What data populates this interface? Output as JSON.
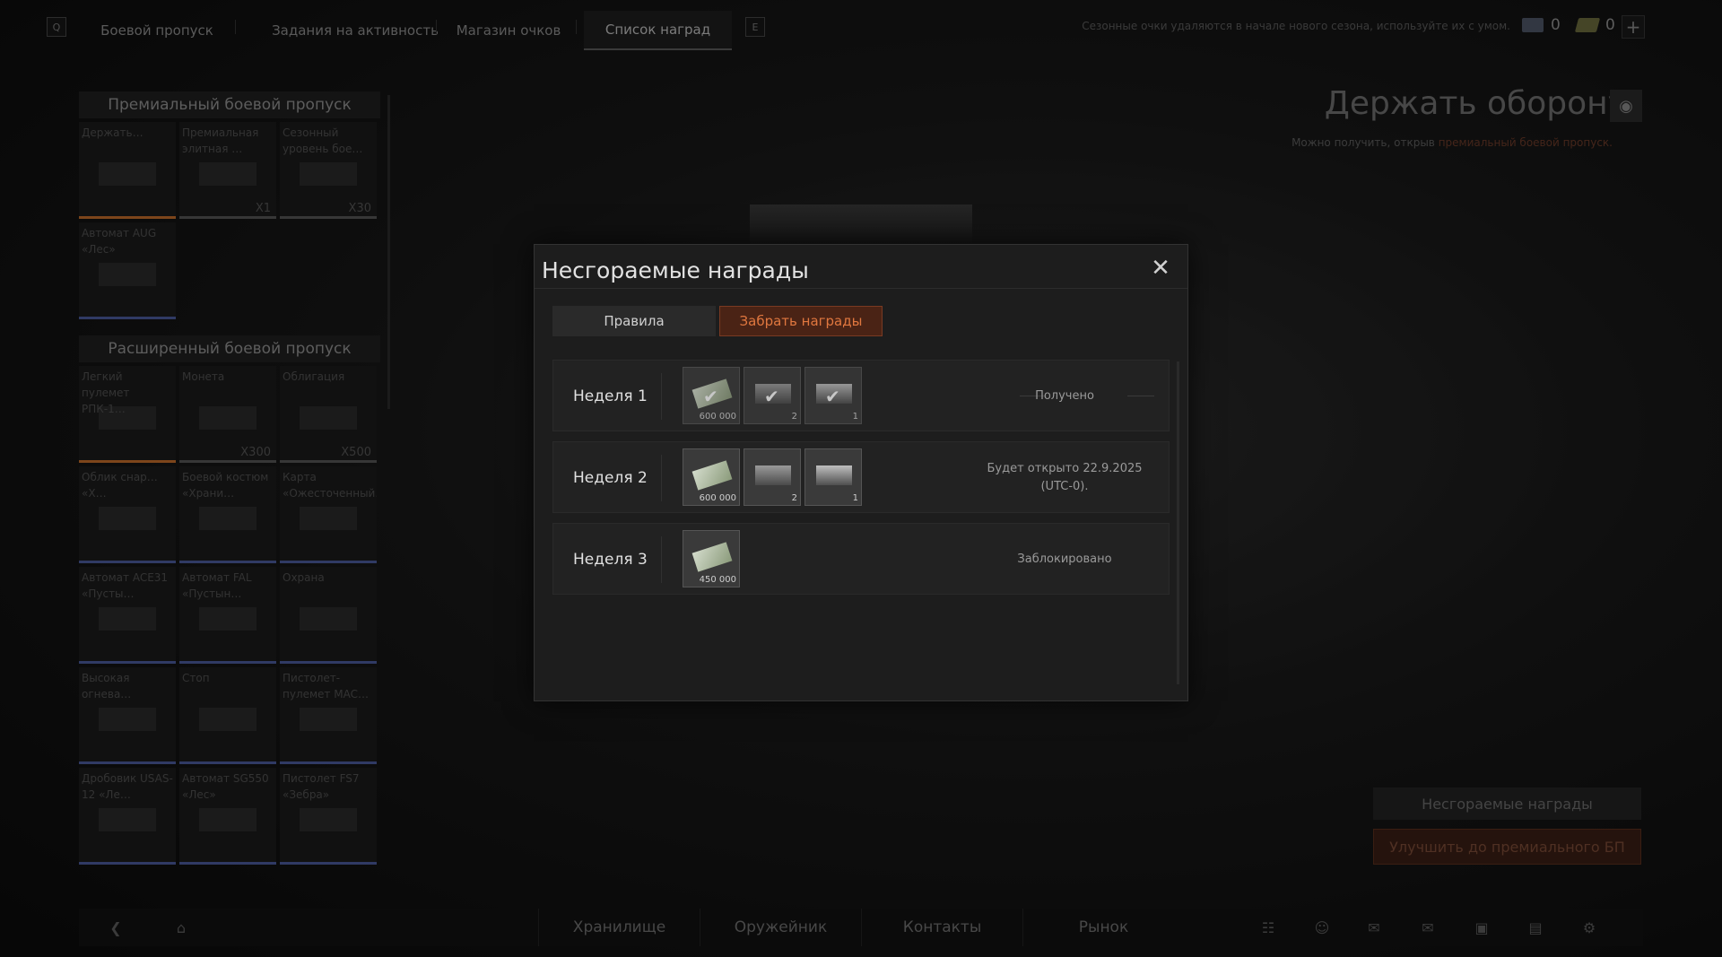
{
  "topnav": {
    "key_left": "Q",
    "key_right": "E",
    "tabs": [
      {
        "label": "Боевой пропуск"
      },
      {
        "label": "Задания на активность"
      },
      {
        "label": "Магазин очков"
      },
      {
        "label": "Список наград"
      }
    ],
    "active_tab": "Список наград",
    "season_note": "Сезонные очки удаляются в начале нового сезона, используйте их с умом.",
    "currency_1": "0",
    "currency_2": "0",
    "plus": "+"
  },
  "left_panel": {
    "premium_title": "Премиальный боевой пропуск",
    "premium_items": [
      {
        "name": "Держать…",
        "qty": "",
        "bar": "#c06a2a"
      },
      {
        "name": "Премиальная элитная …",
        "qty": "X1",
        "bar": "#555555"
      },
      {
        "name": "Сезонный уровень бое…",
        "qty": "X30",
        "bar": "#555555"
      },
      {
        "name": "Автомат AUG «Лес»",
        "qty": "",
        "bar": "#4a5a9a"
      }
    ],
    "extended_title": "Расширенный боевой пропуск",
    "extended_items": [
      {
        "name": "Легкий пулемет РПК-1…",
        "qty": "",
        "bar": "#c06a2a"
      },
      {
        "name": "Монета",
        "qty": "X300",
        "bar": "#555555"
      },
      {
        "name": "Облигация",
        "qty": "X500",
        "bar": "#555555"
      },
      {
        "name": "Облик снар… «Х…",
        "qty": "",
        "bar": "#4a5a9a"
      },
      {
        "name": "Боевой костюм «Храни…",
        "qty": "",
        "bar": "#4a5a9a"
      },
      {
        "name": "Карта «Ожесточенный…",
        "qty": "",
        "bar": "#4a5a9a"
      },
      {
        "name": "Автомат ACE31 «Пусты…",
        "qty": "",
        "bar": "#4a5a9a"
      },
      {
        "name": "Автомат FAL «Пустын…",
        "qty": "",
        "bar": "#4a5a9a"
      },
      {
        "name": "Охрана",
        "qty": "",
        "bar": "#4a5a9a"
      },
      {
        "name": "Высокая огнева…",
        "qty": "",
        "bar": "#4a5a9a"
      },
      {
        "name": "Стоп",
        "qty": "",
        "bar": "#4a5a9a"
      },
      {
        "name": "Пистолет-пулемет MAC…",
        "qty": "",
        "bar": "#4a5a9a"
      },
      {
        "name": "Дробовик USAS-12 «Ле…",
        "qty": "",
        "bar": "#4a5a9a"
      },
      {
        "name": "Автомат SG550 «Лес»",
        "qty": "",
        "bar": "#4a5a9a"
      },
      {
        "name": "Пистолет FS7 «Зебра»",
        "qty": "",
        "bar": "#4a5a9a"
      }
    ]
  },
  "right_panel": {
    "title": "Держать оборону",
    "subtitle_prefix": "Можно получить, открыв",
    "subtitle_link": "премиальный боевой пропуск.",
    "btn_unburnable": "Несгораемые награды",
    "btn_upgrade": "Улучшить до премиального БП"
  },
  "bottombar": {
    "tabs": [
      "Хранилище",
      "Оружейник",
      "Контакты",
      "Рынок"
    ]
  },
  "modal": {
    "title": "Несгораемые награды",
    "close": "✕",
    "tab_rules": "Правила",
    "tab_claim": "Забрать награды",
    "weeks": [
      {
        "label": "Неделя 1",
        "status": "Получено",
        "rewards": [
          {
            "kind": "money",
            "qty": "600 000",
            "claimed": true
          },
          {
            "kind": "box",
            "qty": "2",
            "claimed": true
          },
          {
            "kind": "chest",
            "qty": "1",
            "claimed": true
          }
        ]
      },
      {
        "label": "Неделя 2",
        "status": "Будет открыто 22.9.2025 (UTC-0).",
        "rewards": [
          {
            "kind": "money",
            "qty": "600 000",
            "claimed": false
          },
          {
            "kind": "box",
            "qty": "2",
            "claimed": false
          },
          {
            "kind": "chest",
            "qty": "1",
            "claimed": false
          }
        ]
      },
      {
        "label": "Неделя 3",
        "status": "Заблокировано",
        "rewards": [
          {
            "kind": "money",
            "qty": "450 000",
            "claimed": false
          }
        ]
      }
    ]
  }
}
